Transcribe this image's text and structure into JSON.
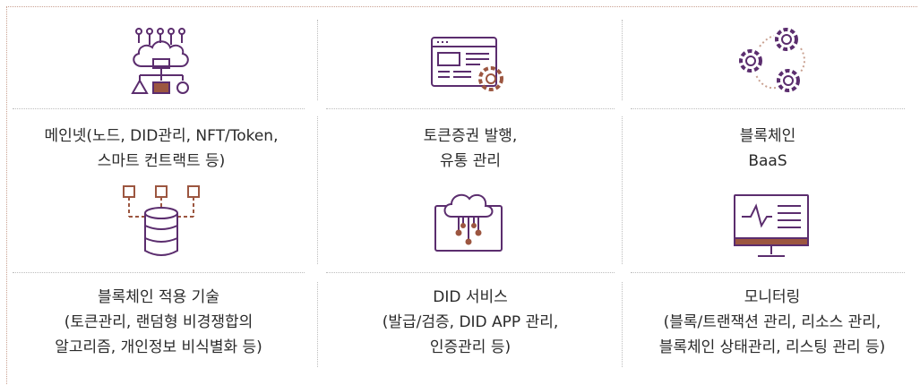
{
  "colors": {
    "icon_purple": "#5b2d6e",
    "icon_brown": "#9c5640",
    "border_dotted": "#c9a191",
    "divider": "#bdbdbd",
    "text": "#2a2a2a"
  },
  "items": [
    {
      "icon": "mainnet-network-icon",
      "lines": [
        "메인넷(노드, DID관리, NFT/Token,",
        "스마트 컨트랙트 등)"
      ]
    },
    {
      "icon": "web-settings-icon",
      "lines": [
        "토큰증권 발행,",
        "유통 관리"
      ]
    },
    {
      "icon": "gears-icon",
      "lines": [
        "블록체인",
        "BaaS"
      ]
    },
    {
      "icon": "database-icon",
      "lines": [
        "블록체인 적용 기술",
        "(토큰관리, 랜덤형 비경쟁합의",
        "알고리즘, 개인정보 비식별화 등)"
      ]
    },
    {
      "icon": "cloud-network-icon",
      "lines": [
        "DID 서비스",
        "(발급/검증, DID APP 관리,",
        "인증관리 등)"
      ]
    },
    {
      "icon": "monitor-icon",
      "lines": [
        "모니터링",
        "(블록/트랜잭션 관리, 리소스 관리,",
        "블록체인 상태관리, 리스팅 관리 등)"
      ]
    }
  ]
}
